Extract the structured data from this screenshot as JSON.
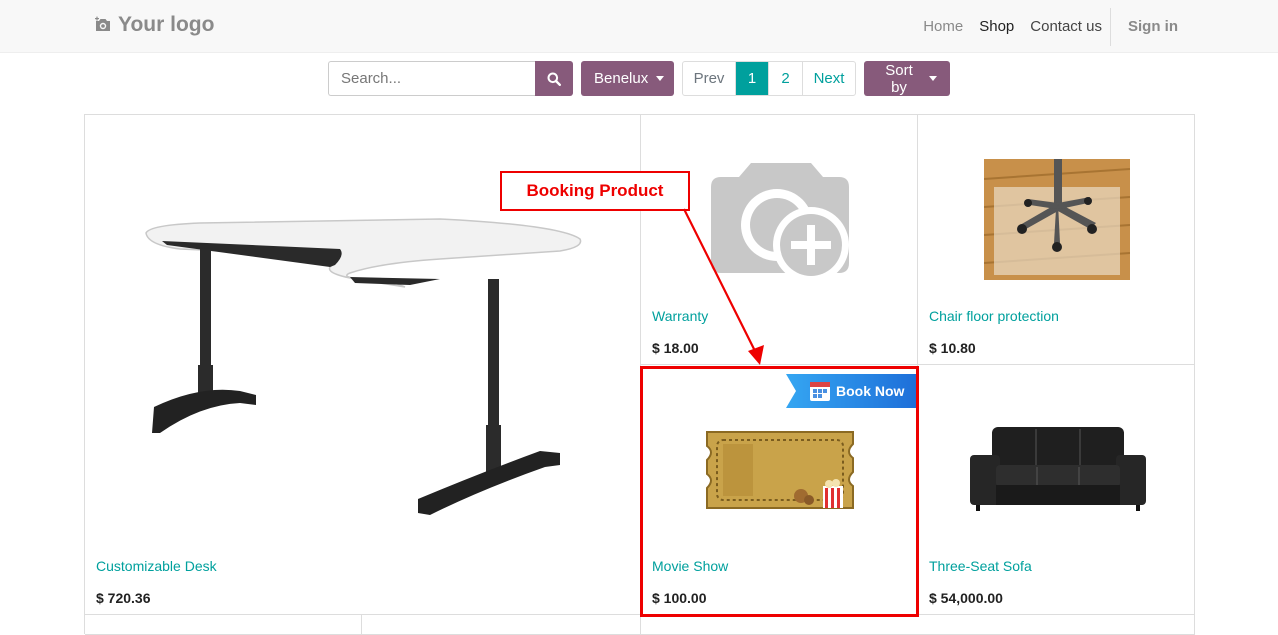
{
  "navbar": {
    "logo": "Your logo",
    "items": [
      "Home",
      "Shop",
      "Contact us"
    ],
    "signin": "Sign in"
  },
  "toolbar": {
    "search_placeholder": "Search...",
    "pricelist": "Benelux",
    "pager": {
      "prev": "Prev",
      "pages": [
        "1",
        "2"
      ],
      "next": "Next",
      "current": "1"
    },
    "sort": "Sort by"
  },
  "products": [
    {
      "name": "Customizable Desk",
      "price": "$ 720.36"
    },
    {
      "name": "Warranty",
      "price": "$ 18.00"
    },
    {
      "name": "Chair floor protection",
      "price": "$ 10.80"
    },
    {
      "name": "Movie Show",
      "price": "$ 100.00",
      "ribbon": "Book Now"
    },
    {
      "name": "Three-Seat Sofa",
      "price": "$ 54,000.00"
    }
  ],
  "annotation": {
    "label": "Booking Product",
    "color": "#e00000"
  },
  "colors": {
    "brand": "#875a7b",
    "accent": "#00A09D"
  },
  "icons": [
    "camera-icon",
    "search-icon",
    "caret-down-icon",
    "calendar-icon"
  ]
}
